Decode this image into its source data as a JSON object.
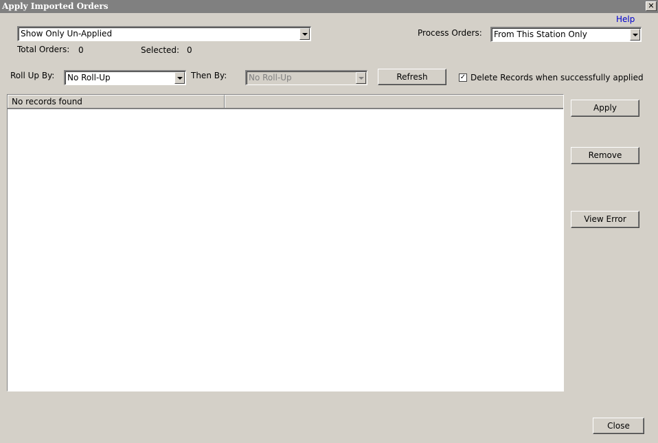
{
  "window": {
    "title": "Apply Imported Orders",
    "close_glyph": "✕"
  },
  "help_link": "Help",
  "filter_select": {
    "value": "Show Only Un-Applied"
  },
  "process_orders": {
    "label": "Process Orders:",
    "value": "From This Station Only"
  },
  "totals": {
    "total_label": "Total Orders:",
    "total_value": "0",
    "selected_label": "Selected:",
    "selected_value": "0"
  },
  "rollup": {
    "label": "Roll Up By:",
    "value": "No Roll-Up"
  },
  "then_by": {
    "label": "Then By:",
    "value": "No Roll-Up",
    "disabled": true
  },
  "refresh_button": "Refresh",
  "delete_records": {
    "label": "Delete Records when successfully applied",
    "checked": true,
    "check_glyph": "✓"
  },
  "grid": {
    "columns": [
      "No records found",
      ""
    ]
  },
  "side_buttons": {
    "apply": "Apply",
    "remove": "Remove",
    "view_error": "View Error"
  },
  "close_button": "Close"
}
